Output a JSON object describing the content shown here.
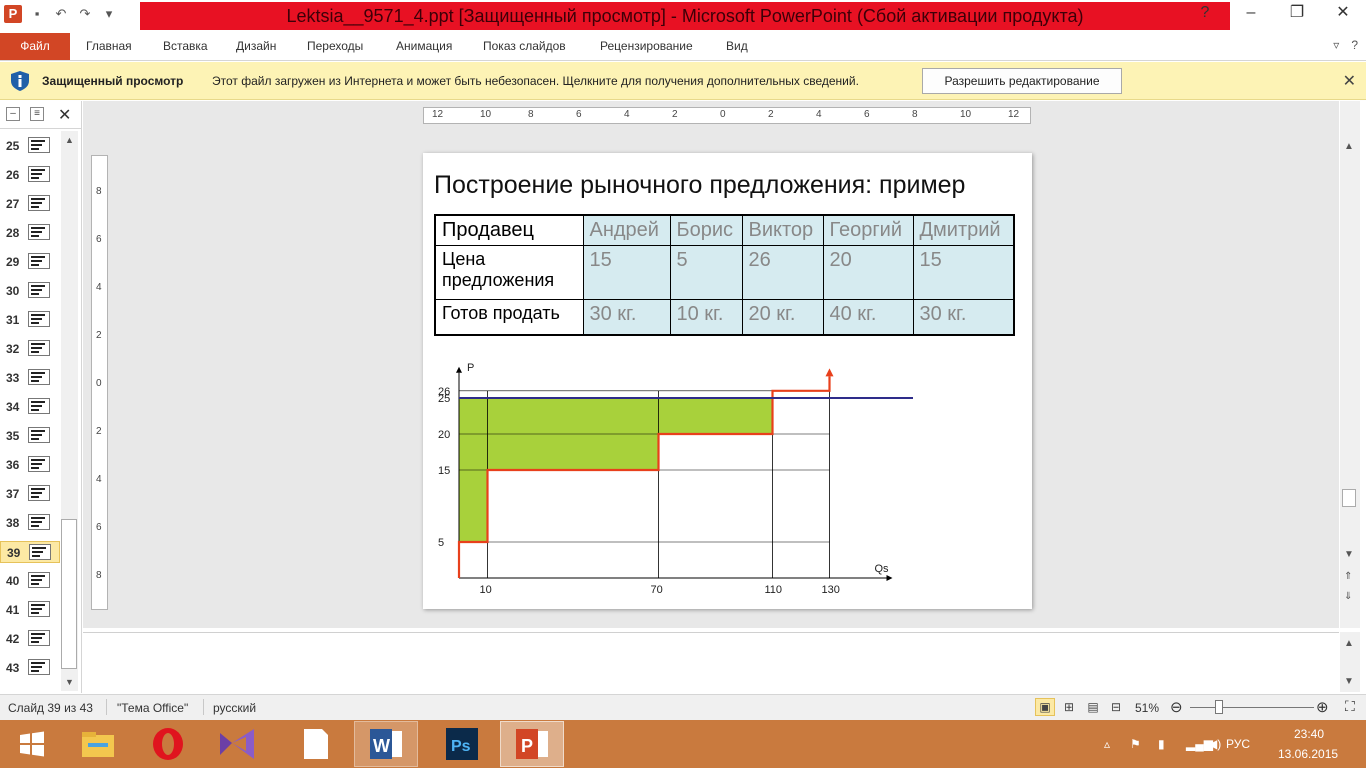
{
  "window": {
    "title": "Lektsia__9571_4.ppt [Защищенный просмотр] - Microsoft PowerPoint (Сбой активации продукта)",
    "qat_icons": [
      "powerpoint-icon",
      "save-icon",
      "undo-icon",
      "redo-icon",
      "customize-icon"
    ],
    "controls": [
      "help-icon",
      "minimize-icon",
      "maximize-icon",
      "close-icon"
    ]
  },
  "ribbon": {
    "file_tab": "Файл",
    "tabs": [
      "Главная",
      "Вставка",
      "Дизайн",
      "Переходы",
      "Анимация",
      "Показ слайдов",
      "Рецензирование",
      "Вид"
    ]
  },
  "protected_view": {
    "title": "Защищенный просмотр",
    "message": "Этот файл загружен из Интернета и может быть небезопасен. Щелкните для получения дополнительных сведений.",
    "button": "Разрешить редактирование"
  },
  "thumbnails": {
    "numbers": [
      "25",
      "26",
      "27",
      "28",
      "29",
      "30",
      "31",
      "32",
      "33",
      "34",
      "35",
      "36",
      "37",
      "38",
      "39",
      "40",
      "41",
      "42",
      "43"
    ],
    "active": "39"
  },
  "rulers": {
    "horizontal": [
      "12",
      "10",
      "8",
      "6",
      "4",
      "2",
      "0",
      "2",
      "4",
      "6",
      "8",
      "10",
      "12"
    ],
    "vertical": [
      "8",
      "6",
      "4",
      "2",
      "0",
      "2",
      "4",
      "6",
      "8"
    ]
  },
  "slide": {
    "title": "Построение рыночного предложения: пример",
    "table": {
      "header": [
        "Продавец",
        "Андрей",
        "Борис",
        "Виктор",
        "Георгий",
        "Дмитрий"
      ],
      "rows": [
        [
          "Цена предложения",
          "15",
          "5",
          "26",
          "20",
          "15"
        ],
        [
          "Готов продать",
          "30 кг.",
          "10 кг.",
          "20 кг.",
          "40 кг.",
          "30 кг."
        ]
      ]
    }
  },
  "chart_data": {
    "type": "line",
    "title": "",
    "xlabel": "Qs",
    "ylabel": "P",
    "x_ticks": [
      10,
      70,
      110,
      130
    ],
    "y_ticks": [
      5,
      15,
      20,
      25,
      26
    ],
    "xlim": [
      0,
      170
    ],
    "ylim": [
      0,
      28
    ],
    "series": [
      {
        "name": "",
        "color": "#e8401c",
        "points": [
          [
            0,
            0
          ],
          [
            0,
            5
          ],
          [
            10,
            5
          ],
          [
            10,
            15
          ],
          [
            70,
            15
          ],
          [
            70,
            20
          ],
          [
            110,
            20
          ],
          [
            110,
            26
          ],
          [
            130,
            26
          ],
          [
            130,
            28
          ]
        ]
      },
      {
        "name": "",
        "color": "#2e2c8a",
        "points": [
          [
            0,
            25
          ],
          [
            170,
            25
          ]
        ]
      }
    ],
    "shaded_area": {
      "color": "#a8d13b",
      "between_price": 25,
      "boundary": [
        [
          0,
          5
        ],
        [
          10,
          5
        ],
        [
          10,
          15
        ],
        [
          70,
          15
        ],
        [
          70,
          20
        ],
        [
          110,
          20
        ],
        [
          110,
          25
        ]
      ]
    }
  },
  "status": {
    "slide_info": "Слайд 39 из 43",
    "theme": "\"Тема Office\"",
    "language": "русский",
    "zoom": "51%",
    "zoom_fraction": 0.51
  },
  "taskbar": {
    "apps": [
      "start-icon",
      "explorer-icon",
      "opera-icon",
      "visual-studio-icon",
      "document-icon",
      "word-icon",
      "photoshop-icon",
      "powerpoint-icon"
    ],
    "language": "РУС",
    "time": "23:40",
    "date": "13.06.2015"
  },
  "colors": {
    "title_red": "#e81123",
    "file_tab": "#d24625",
    "protected_bar": "#fdf3b5",
    "table_value_bg": "#d6ebf0",
    "taskbar": "#c97a3e"
  }
}
